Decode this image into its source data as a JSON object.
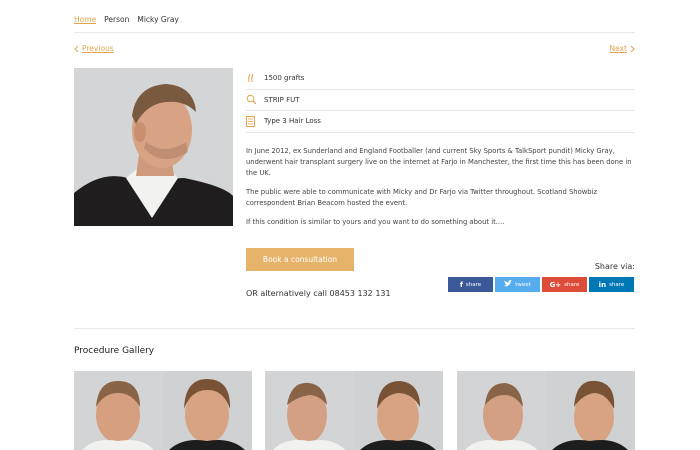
{
  "breadcrumb": {
    "home": "Home",
    "items": [
      "Person",
      "Micky Gray"
    ]
  },
  "pager": {
    "prev": "Previous",
    "next": "Next"
  },
  "facts": [
    {
      "icon": "hair-follicle-icon",
      "text": "1500 grafts"
    },
    {
      "icon": "magnifier-icon",
      "text": "STRIP FUT"
    },
    {
      "icon": "document-icon",
      "text": "Type 3 Hair Loss"
    }
  ],
  "description": [
    "In June 2012, ex Sunderland and England Footballer (and current Sky Sports & TalkSport pundit) Micky Gray, underwent hair transplant surgery live on the internet at Farjo in Manchester, the first time this has been done in the UK.",
    "The public were able to communicate with Micky and Dr Farjo via Twitter throughout. Scotland Showbiz correspondent Brian Beacom hosted the event.",
    "If this condition is similar to yours and you want to do something about it...."
  ],
  "cta": {
    "label": "Book a consultation",
    "alternative": "OR alternatively call 08453 132 131"
  },
  "share": {
    "title": "Share via:",
    "buttons": [
      {
        "icon": "facebook-icon",
        "glyph": "f",
        "label": "share",
        "color": "#3b5998"
      },
      {
        "icon": "twitter-icon",
        "glyph": "❧",
        "label": "tweet",
        "color": "#55acee"
      },
      {
        "icon": "google-plus-icon",
        "glyph": "G+",
        "label": "share",
        "color": "#dd4b39"
      },
      {
        "icon": "linkedin-icon",
        "glyph": "in",
        "label": "share",
        "color": "#0077b5"
      }
    ]
  },
  "gallery": {
    "title": "Procedure Gallery"
  },
  "colors": {
    "accent": "#e3a44f",
    "button": "#e5b46a"
  }
}
